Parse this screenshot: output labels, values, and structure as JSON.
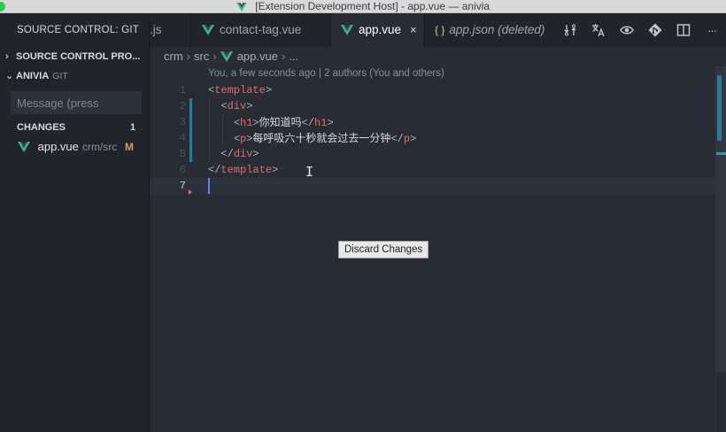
{
  "window": {
    "title": "[Extension Development Host] - app.vue — anivia"
  },
  "sidebar": {
    "title": "SOURCE CONTROL: GIT",
    "providers_section": "SOURCE CONTROL PRO...",
    "repo": {
      "name": "ANIVIA",
      "provider": "GIT"
    },
    "message_placeholder": "Message (press",
    "changes": {
      "label": "CHANGES",
      "count": "1",
      "files": [
        {
          "name": "app.vue",
          "path": "crm/src",
          "status": "M"
        }
      ]
    }
  },
  "tabs": [
    {
      "label": ".js",
      "active": false
    },
    {
      "label": "contact-tag.vue",
      "active": false
    },
    {
      "label": "app.vue",
      "active": true,
      "close": "×"
    },
    {
      "label": "app.json (deleted)",
      "active": false,
      "icon_text": "{ }"
    }
  ],
  "tab_actions": [
    "open-changes-icon",
    "translate-icon",
    "preview-icon",
    "git-compare-icon",
    "split-editor-icon",
    "more-icon"
  ],
  "tab_actions_more": "···",
  "breadcrumb": {
    "parts": [
      "crm",
      "src",
      "app.vue",
      "..."
    ]
  },
  "editor": {
    "codelens": "You, a few seconds ago | 2 authors (You and others)",
    "lines": [
      {
        "n": "1",
        "indent": "",
        "open": "<",
        "tag": "template",
        "close": ">",
        "text": "",
        "open2": "",
        "tag2": "",
        "close2": ""
      },
      {
        "n": "2",
        "indent": "  ",
        "open": "<",
        "tag": "div",
        "close": ">",
        "text": "",
        "open2": "",
        "tag2": "",
        "close2": ""
      },
      {
        "n": "3",
        "indent": "    ",
        "open": "<",
        "tag": "h1",
        "close": ">",
        "text": "你知道吗",
        "open2": "</",
        "tag2": "h1",
        "close2": ">"
      },
      {
        "n": "4",
        "indent": "    ",
        "open": "<",
        "tag": "p",
        "close": ">",
        "text": "每呼吸六十秒就会过去一分钟",
        "open2": "</",
        "tag2": "p",
        "close2": ">"
      },
      {
        "n": "5",
        "indent": "  ",
        "open": "</",
        "tag": "div",
        "close": ">",
        "text": "",
        "open2": "",
        "tag2": "",
        "close2": ""
      },
      {
        "n": "6",
        "indent": "",
        "open": "</",
        "tag": "template",
        "close": ">",
        "text": "",
        "open2": "",
        "tag2": "",
        "close2": ""
      },
      {
        "n": "7",
        "indent": "",
        "open": "",
        "tag": "",
        "close": "",
        "text": "",
        "open2": "",
        "tag2": "",
        "close2": ""
      }
    ],
    "ibeam": "I"
  },
  "tooltip": "Discard Changes",
  "colors": {
    "vue_green": "#41b883",
    "gutter_modified": "#2b7a98",
    "tag": "#e06c75",
    "modified_badge": "#d19a66"
  }
}
